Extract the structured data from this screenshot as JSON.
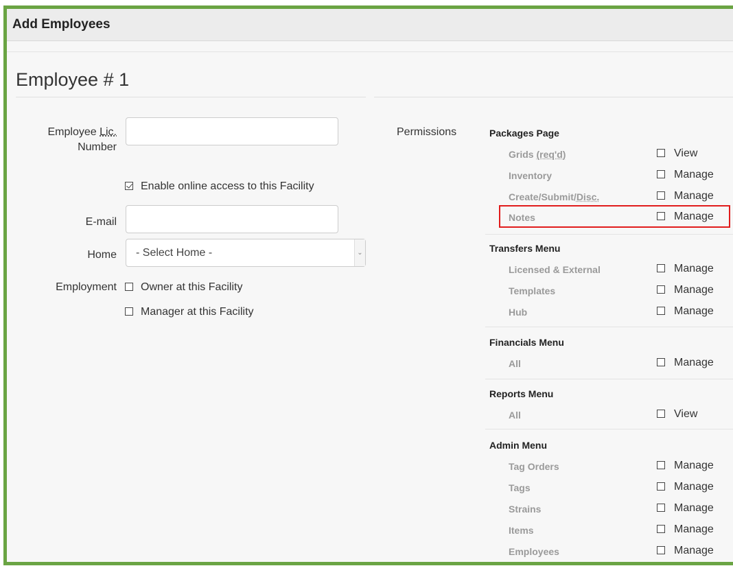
{
  "window": {
    "title": "Add Employees"
  },
  "employee": {
    "heading": "Employee # 1"
  },
  "form": {
    "lic_label_prefix": "Employee ",
    "lic_label_abbr": "Lic.",
    "lic_label_suffix": "Number",
    "lic_value": "",
    "online_access_label": "Enable online access to this Facility",
    "online_access_checked": true,
    "email_label": "E-mail",
    "email_value": "",
    "home_label": "Home",
    "home_selected": "- Select Home -",
    "employment_label": "Employment",
    "owner_label": "Owner at this Facility",
    "manager_label": "Manager at this Facility"
  },
  "permissions": {
    "label": "Permissions",
    "groups": [
      {
        "title": "Packages Page",
        "items": [
          {
            "name_prefix": "Grids ",
            "name_abbr": "(req'd)",
            "option": "View"
          },
          {
            "name": "Inventory",
            "option": "Manage"
          },
          {
            "name_prefix": "Create/Submit/",
            "name_abbr": "Disc.",
            "option": "Manage"
          },
          {
            "name": "Notes",
            "option": "Manage",
            "highlighted": true
          }
        ]
      },
      {
        "title": "Transfers Menu",
        "items": [
          {
            "name": "Licensed & External",
            "option": "Manage"
          },
          {
            "name": "Templates",
            "option": "Manage"
          },
          {
            "name": "Hub",
            "option": "Manage"
          }
        ]
      },
      {
        "title": "Financials Menu",
        "items": [
          {
            "name": "All",
            "option": "Manage"
          }
        ]
      },
      {
        "title": "Reports Menu",
        "items": [
          {
            "name": "All",
            "option": "View"
          }
        ]
      },
      {
        "title": "Admin Menu",
        "items": [
          {
            "name": "Tag Orders",
            "option": "Manage"
          },
          {
            "name": "Tags",
            "option": "Manage"
          },
          {
            "name": "Strains",
            "option": "Manage"
          },
          {
            "name": "Items",
            "option": "Manage"
          },
          {
            "name": "Employees",
            "option": "Manage"
          }
        ]
      }
    ]
  },
  "colors": {
    "frame_border": "#6aa443",
    "highlight_border": "#e11b1b"
  }
}
